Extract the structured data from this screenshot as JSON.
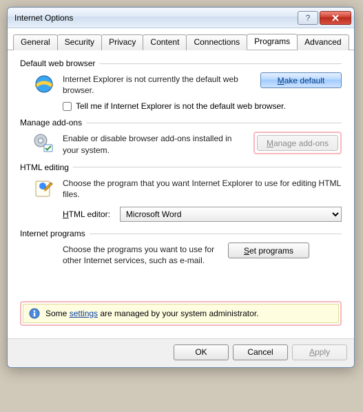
{
  "window_title": "Internet Options",
  "tabs": [
    "General",
    "Security",
    "Privacy",
    "Content",
    "Connections",
    "Programs",
    "Advanced"
  ],
  "active_tab_index": 5,
  "groups": {
    "default_browser": {
      "title": "Default web browser",
      "desc": "Internet Explorer is not currently the default web browser.",
      "button": "Make default",
      "checkbox_label": "Tell me if Internet Explorer is not the default web browser."
    },
    "addons": {
      "title": "Manage add-ons",
      "desc": "Enable or disable browser add-ons installed in your system.",
      "button": "Manage add-ons"
    },
    "html_editing": {
      "title": "HTML editing",
      "desc": "Choose the program that you want Internet Explorer to use for editing HTML files.",
      "label": "HTML editor:",
      "selected": "Microsoft Word"
    },
    "programs": {
      "title": "Internet programs",
      "desc": "Choose the programs you want to use for other Internet services, such as e-mail.",
      "button": "Set programs"
    }
  },
  "info_prefix": "Some ",
  "info_link": "settings",
  "info_suffix": " are managed by your system administrator.",
  "buttons": {
    "ok": "OK",
    "cancel": "Cancel",
    "apply": "Apply"
  }
}
